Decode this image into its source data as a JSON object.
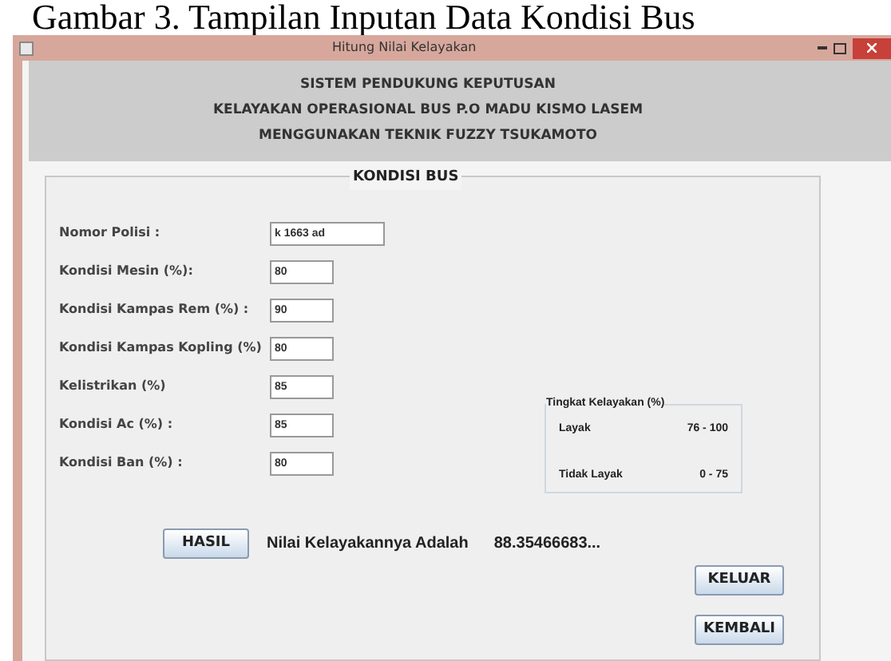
{
  "caption": "Gambar 3. Tampilan Inputan Data Kondisi Bus",
  "window": {
    "title": "Hitung Nilai Kelayakan"
  },
  "header": [
    "SISTEM PENDUKUNG KEPUTUSAN",
    "KELAYAKAN OPERASIONAL BUS P.O MADU KISMO LASEM",
    "MENGGUNAKAN TEKNIK FUZZY TSUKAMOTO"
  ],
  "panel": {
    "title": "KONDISI BUS",
    "fields": [
      {
        "label": "Nomor Polisi :",
        "value": "k 1663 ad"
      },
      {
        "label": "Kondisi Mesin (%):",
        "value": "80"
      },
      {
        "label": "Kondisi Kampas Rem (%) :",
        "value": "90"
      },
      {
        "label": "Kondisi Kampas Kopling (%)",
        "value": "80"
      },
      {
        "label": "Kelistrikan (%)",
        "value": "85"
      },
      {
        "label": "Kondisi Ac (%) :",
        "value": "85"
      },
      {
        "label": "Kondisi Ban (%) :",
        "value": "80"
      }
    ]
  },
  "legend": {
    "title": "Tingkat Kelayakan (%)",
    "rows": [
      {
        "label": "Layak",
        "range": "76 - 100"
      },
      {
        "label": "Tidak Layak",
        "range": "0 - 75"
      }
    ]
  },
  "result": {
    "button": "HASIL",
    "label": "Nilai Kelayakannya Adalah",
    "value": "88.35466683..."
  },
  "buttons": [
    "KELUAR",
    "KEMBALI"
  ]
}
